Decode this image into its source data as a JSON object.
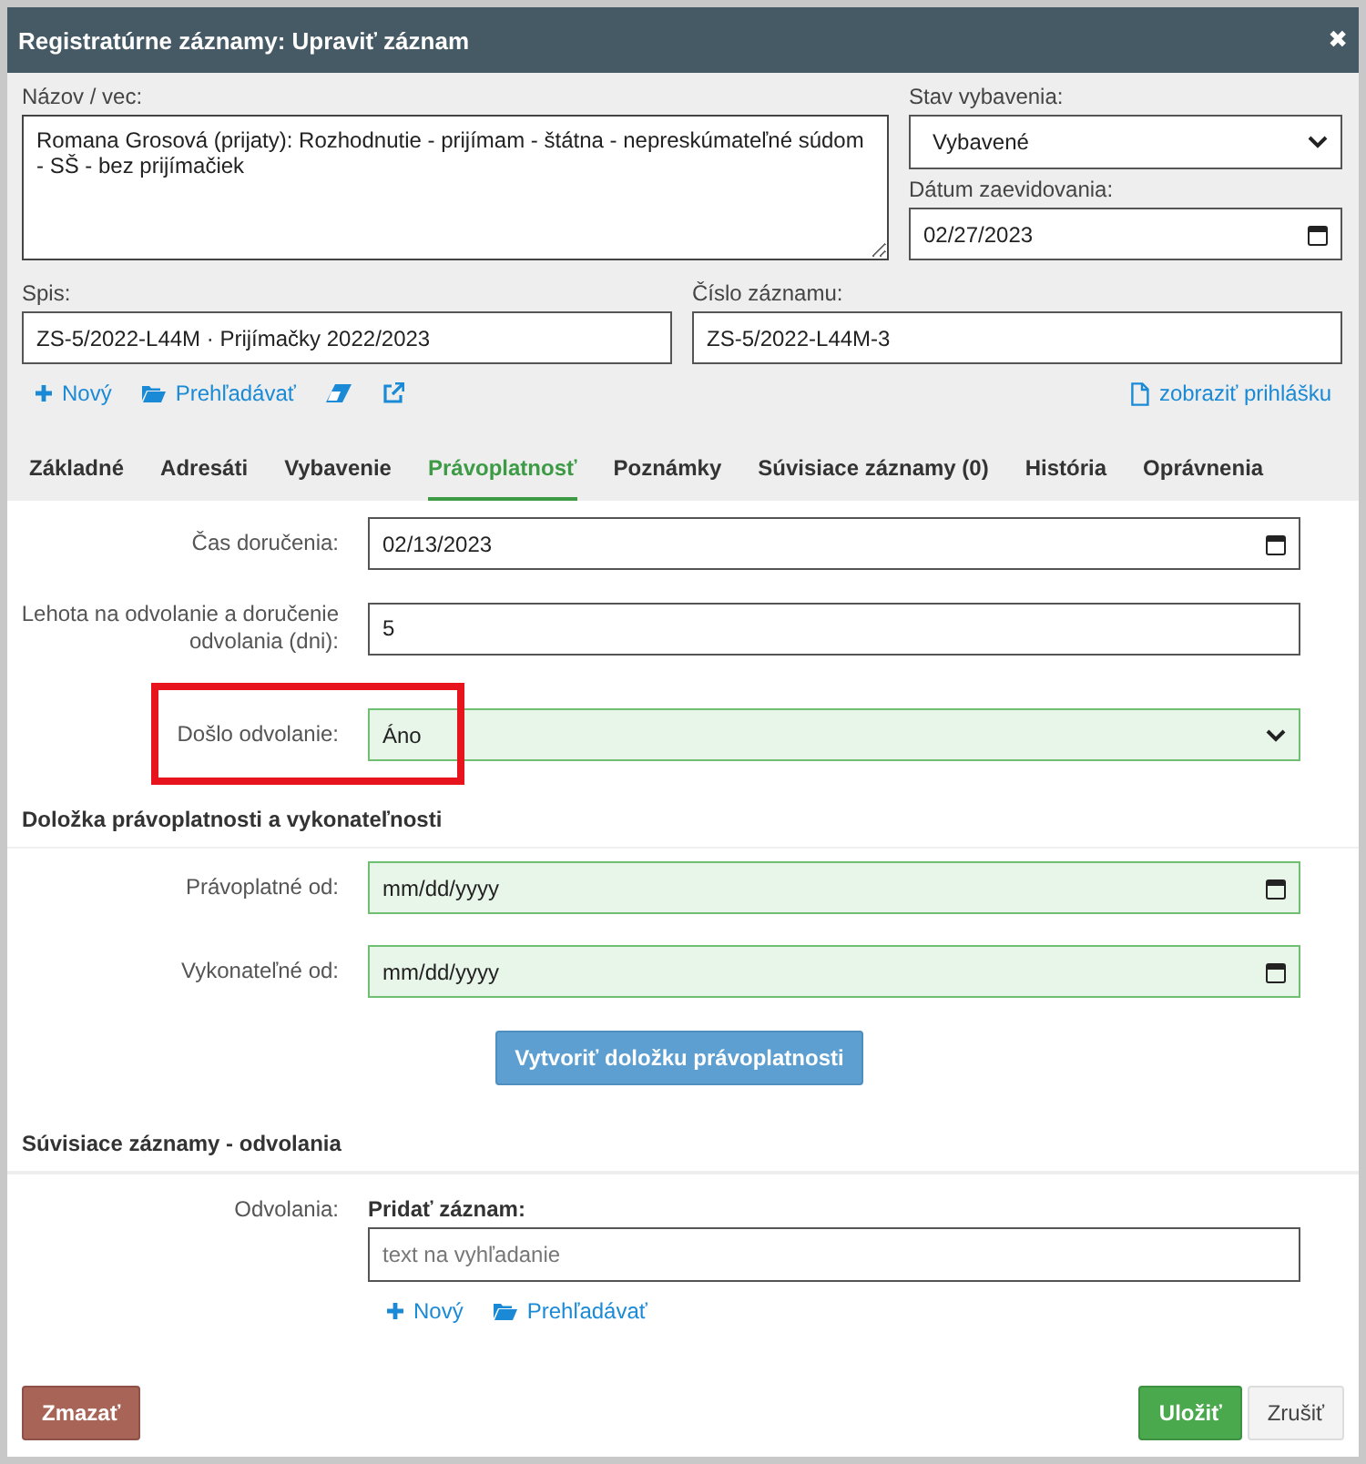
{
  "window": {
    "title": "Registratúrne záznamy: Upraviť záznam",
    "close": "✖"
  },
  "header": {
    "subject": {
      "label": "Názov / vec:",
      "value": "Romana Grosová (prijaty): Rozhodnutie - prijímam - štátna - nepreskúmateľné súdom - SŠ - bez prijímačiek"
    },
    "status": {
      "label": "Stav vybavenia:",
      "value": "Vybavené"
    },
    "filed_date": {
      "label": "Dátum zaevidovania:",
      "value": "02/27/2023"
    },
    "file": {
      "label": "Spis:",
      "value": "ZS-5/2022-L44M · Prijímačky 2022/2023"
    },
    "record_number": {
      "label": "Číslo záznamu:",
      "value": "ZS-5/2022-L44M-3"
    },
    "actions": [
      {
        "kind": "new",
        "label": "Nový"
      },
      {
        "kind": "browse",
        "label": "Prehľadávať"
      },
      {
        "kind": "erase"
      },
      {
        "kind": "external"
      }
    ],
    "show_application": "zobraziť prihlášku"
  },
  "tabs": [
    {
      "label": "Základné",
      "selected": false
    },
    {
      "label": "Adresáti",
      "selected": false
    },
    {
      "label": "Vybavenie",
      "selected": false
    },
    {
      "label": "Právoplatnosť",
      "selected": true
    },
    {
      "label": "Poznámky",
      "selected": false
    },
    {
      "label": "Súvisiace záznamy (0)",
      "selected": false
    },
    {
      "label": "História",
      "selected": false
    },
    {
      "label": "Oprávnenia",
      "selected": false
    }
  ],
  "fields": [
    {
      "kind": "date",
      "label": "Čas doručenia:",
      "value": "02/13/2023",
      "valid": false,
      "highlighted": false
    },
    {
      "kind": "text",
      "label": "Lehota na odvolanie a doručenie odvolania (dni):",
      "value": "5",
      "valid": false,
      "highlighted": false
    },
    {
      "kind": "select",
      "label": "Došlo odvolanie:",
      "value": "Áno",
      "valid": true,
      "highlighted": true
    }
  ],
  "clause": {
    "heading": "Doložka právoplatnosti a vykonateľnosti",
    "fields": [
      {
        "kind": "date",
        "label": "Právoplatné od:",
        "placeholder": "mm/dd/yyyy",
        "valid": true,
        "highlighted": false
      },
      {
        "kind": "date",
        "label": "Vykonateľné od:",
        "placeholder": "mm/dd/yyyy",
        "valid": true,
        "highlighted": false
      }
    ],
    "button": "Vytvoriť doložku právoplatnosti"
  },
  "related": {
    "heading": "Súvisiace záznamy - odvolania",
    "label": "Odvolania:",
    "add_label": "Pridať záznam:",
    "search_placeholder": "text na vyhľadanie",
    "actions": [
      {
        "kind": "new",
        "label": "Nový"
      },
      {
        "kind": "browse",
        "label": "Prehľadávať"
      }
    ]
  },
  "footer": {
    "delete": "Zmazať",
    "save": "Uložiť",
    "cancel": "Zrušiť"
  }
}
